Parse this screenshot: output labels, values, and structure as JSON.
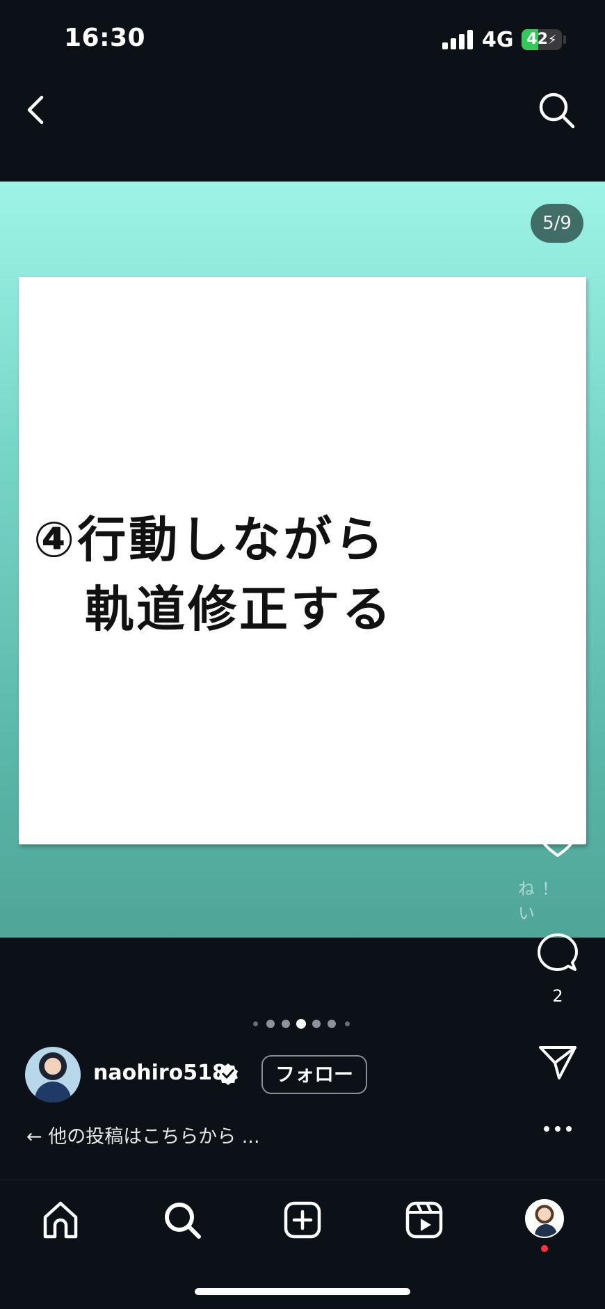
{
  "status_bar": {
    "time": "16:30",
    "network": "4G",
    "battery_level": "42",
    "battery_fraction": 0.42,
    "signal_bars": 4
  },
  "header": {
    "back_icon": "chevron-left-icon",
    "search_icon": "search-icon"
  },
  "post": {
    "counter": "5/9",
    "slide_text": "④行動しながら\n　軌道修正する",
    "carousel": {
      "total": 7,
      "active_index": 3
    },
    "colors": {
      "gradient_top": "#9ef4e6",
      "gradient_bottom": "#4fa598",
      "card": "#ffffff"
    }
  },
  "actions": {
    "like_icon": "heart-icon",
    "like_caption": "ね！ い",
    "comment_icon": "comment-icon",
    "comment_count": "2",
    "share_icon": "paper-plane-icon",
    "more_icon": "more-dots-icon"
  },
  "author": {
    "username": "naohiro518",
    "verified": true,
    "follow_label": "フォロー"
  },
  "caption": {
    "text": "← 他の投稿はこちらから ..."
  },
  "tab_bar": {
    "items": [
      "home-icon",
      "search-icon",
      "create-icon",
      "reels-icon",
      "profile-avatar"
    ],
    "notification_color": "#ff3040"
  }
}
